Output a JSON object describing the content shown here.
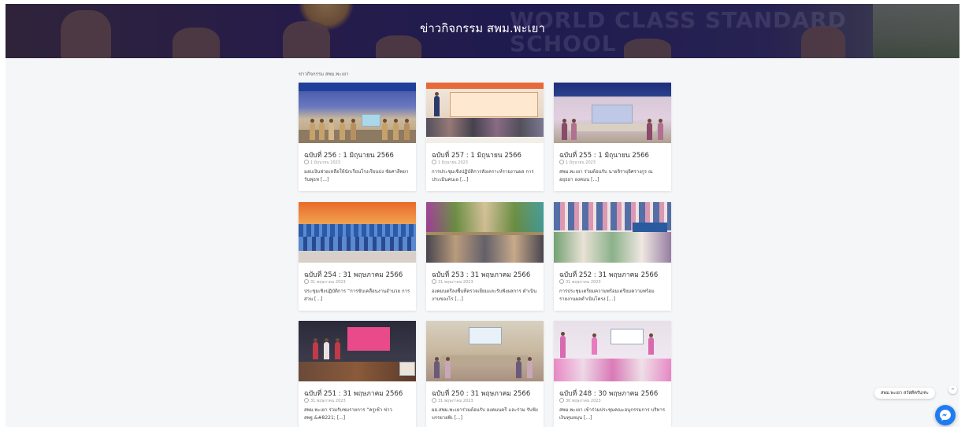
{
  "hero": {
    "title": "ข่าวกิจกรรม สพม.พะเยา",
    "background_text": "WORLD CLASS STANDARD SCHOOL"
  },
  "breadcrumb": "ข่าวกิจกรรม สพม.พะเยา",
  "posts": [
    {
      "title": "ฉบับที่ 256 : 1 มิถุนายน 2566",
      "date": "1 มิถุนายน 2023",
      "excerpt": "มอบเงินช่วยเหลือให้นักเรียนโรงเรียนปง ชัยศาลีพยา วันพุธท [...]"
    },
    {
      "title": "ฉบับที่ 257 : 1 มิถุนายน 2566",
      "date": "1 มิถุนายน 2023",
      "excerpt": "การประชุมเชิงปฏิบัติการสังเคราะห์รายงานผล การประเมินคนเอ [...]"
    },
    {
      "title": "ฉบับที่ 255 : 1 มิถุนายน 2566",
      "date": "1 มิถุนายน 2023",
      "excerpt": "สพม.พะเยา ร่วมต้อนรับ นายจิรายุอิศรางกูร ณ อยุธยา องคมน [...]"
    },
    {
      "title": "ฉบับที่ 254 : 31 พฤษภาคม 2566",
      "date": "31 พฤษภาคม 2023",
      "excerpt": "ประชุมเชิงปฏิบัติการ “การขับเคลื่อนงานอำนวย การส่วน [...]"
    },
    {
      "title": "ฉบับที่ 253 : 31 พฤษภาคม 2566",
      "date": "31 พฤษภาคม 2023",
      "excerpt": "องคมนตรีลงพื้นที่ตรวจเยี่ยมและรับฟังผลการ ดำเนินงานของโร [...]"
    },
    {
      "title": "ฉบับที่ 252 : 31 พฤษภาคม 2566",
      "date": "31 พฤษภาคม 2023",
      "excerpt": "การประชุมเตรียมความพร้อมเตรียมความพร้อม รายงานผลดำเนินโครง [...]"
    },
    {
      "title": "ฉบับที่ 251 : 31 พฤษภาคม 2566",
      "date": "31 พฤษภาคม 2023",
      "excerpt": "สพม.พะเยา ร่วมรับชมรายการ “ครูเช้า ข่าว สพฐ.&#8221; [...]"
    },
    {
      "title": "ฉบับที่ 250 : 31 พฤษภาคม 2566",
      "date": "31 พฤษภาคม 2023",
      "excerpt": "ผอ.สพม.พะเยาร่วมต้อนรับ องคมนตรี และร่วม รับฟังบรรยายพิเ [...]"
    },
    {
      "title": "ฉบับที่ 248 : 30 พฤษภาคม 2566",
      "date": "30 พฤษภาคม 2023",
      "excerpt": "สพม.พะเยา เข้าร่วมประชุมคณะอนุกรรมการ บริหารเงินทุนหมุน [...]"
    }
  ],
  "chat": {
    "greeting": "สพม.พะเยา สวัสดีครับ/ค่ะ",
    "close_label": "–"
  },
  "colors": {
    "page_background": "#f5f6f8",
    "card_background": "#ffffff",
    "messenger_blue": "#1e7cf2",
    "hero_overlay": "#21205b"
  }
}
